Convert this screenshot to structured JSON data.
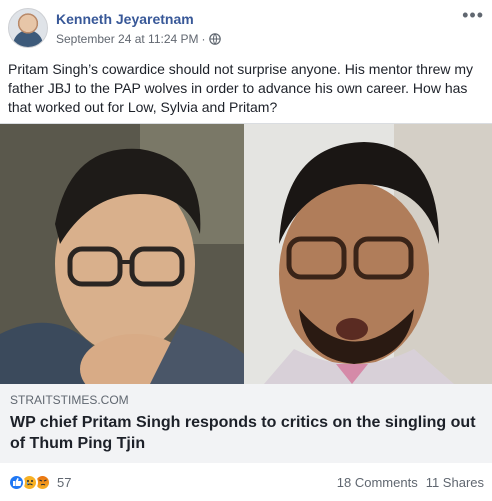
{
  "post": {
    "author": "Kenneth Jeyaretnam",
    "timestamp": "September 24 at 11:24 PM",
    "separator": "·",
    "text": "Pritam Singh’s cowardice should not surprise anyone. His mentor threw my father JBJ to the PAP wolves in order to advance his own career. How has that worked out for Low, Sylvia and Pritam?",
    "more_label": "•••"
  },
  "link": {
    "domain": "STRAITSTIMES.COM",
    "title": "WP chief Pritam Singh responds to critics on the singling out of Thum Ping Tjin"
  },
  "footer": {
    "reactions": [
      "like-icon",
      "sad-icon",
      "angry-icon"
    ],
    "reaction_count": "57",
    "comments": "18 Comments",
    "shares": "11 Shares"
  },
  "colors": {
    "author": "#385898",
    "like": "#2078f4",
    "sad": "#f7b125",
    "angry": "#e9710f",
    "link_bg": "#f2f3f5"
  }
}
